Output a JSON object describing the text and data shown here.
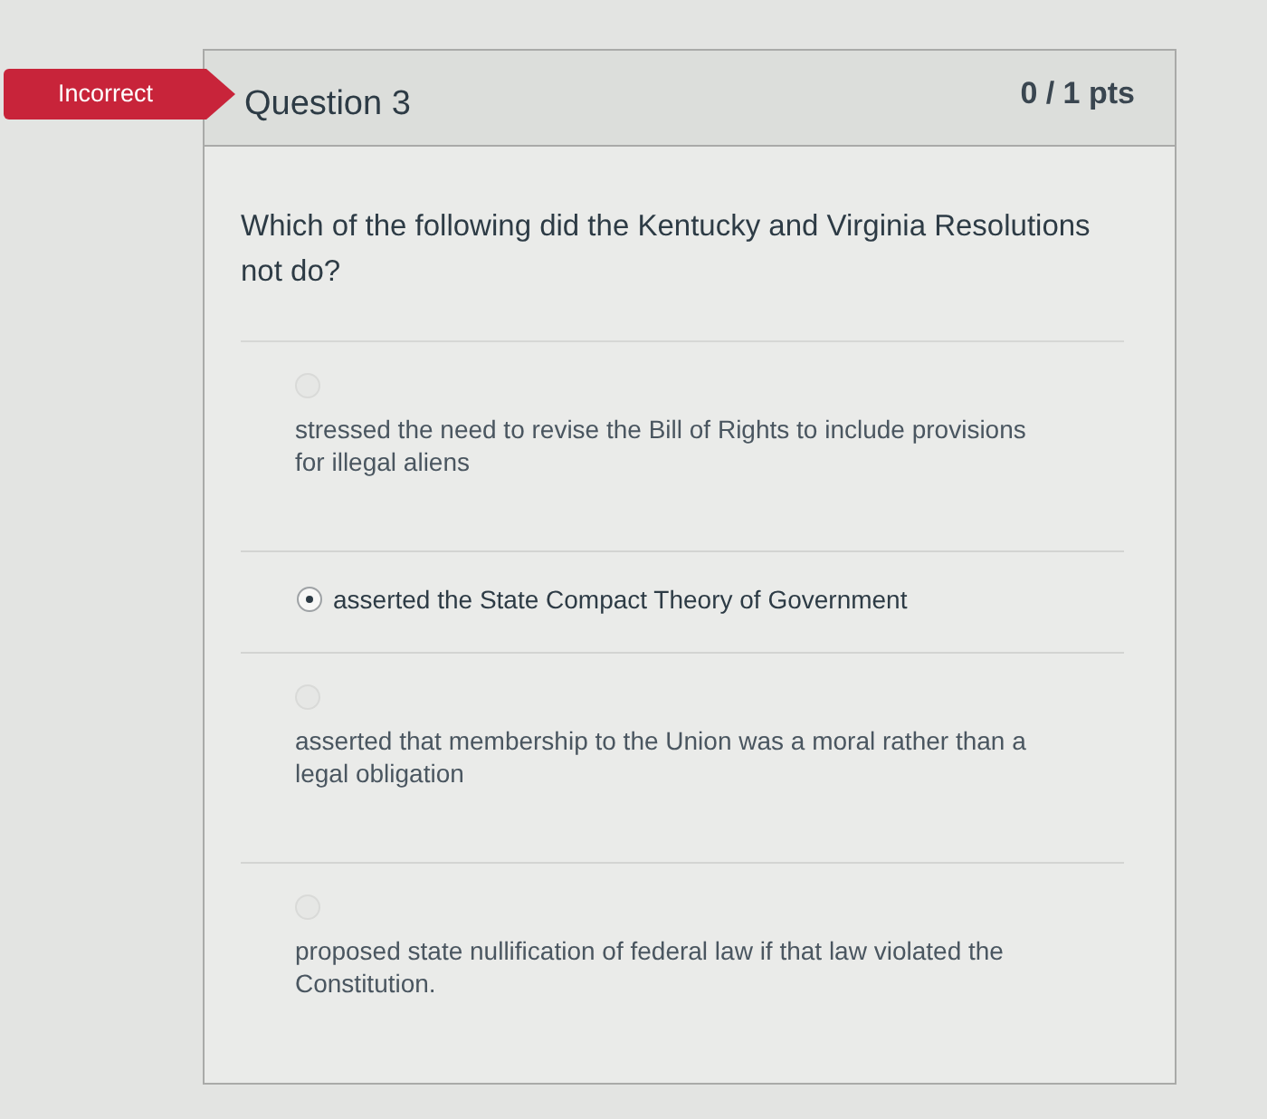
{
  "result_badge": {
    "label": "Incorrect"
  },
  "question": {
    "title": "Question 3",
    "points": "0 / 1 pts",
    "text": "Which of the following did the Kentucky and Virginia Resolutions not do?",
    "answers": [
      {
        "text": "stressed the need to revise the Bill of Rights to include provisions for illegal aliens",
        "selected": false
      },
      {
        "text": "asserted the State Compact Theory of Government",
        "selected": true
      },
      {
        "text": "asserted that membership to the Union was a moral rather than a legal obligation",
        "selected": false
      },
      {
        "text": "proposed state nullification of federal law if that law violated the Constitution.",
        "selected": false
      }
    ]
  }
}
